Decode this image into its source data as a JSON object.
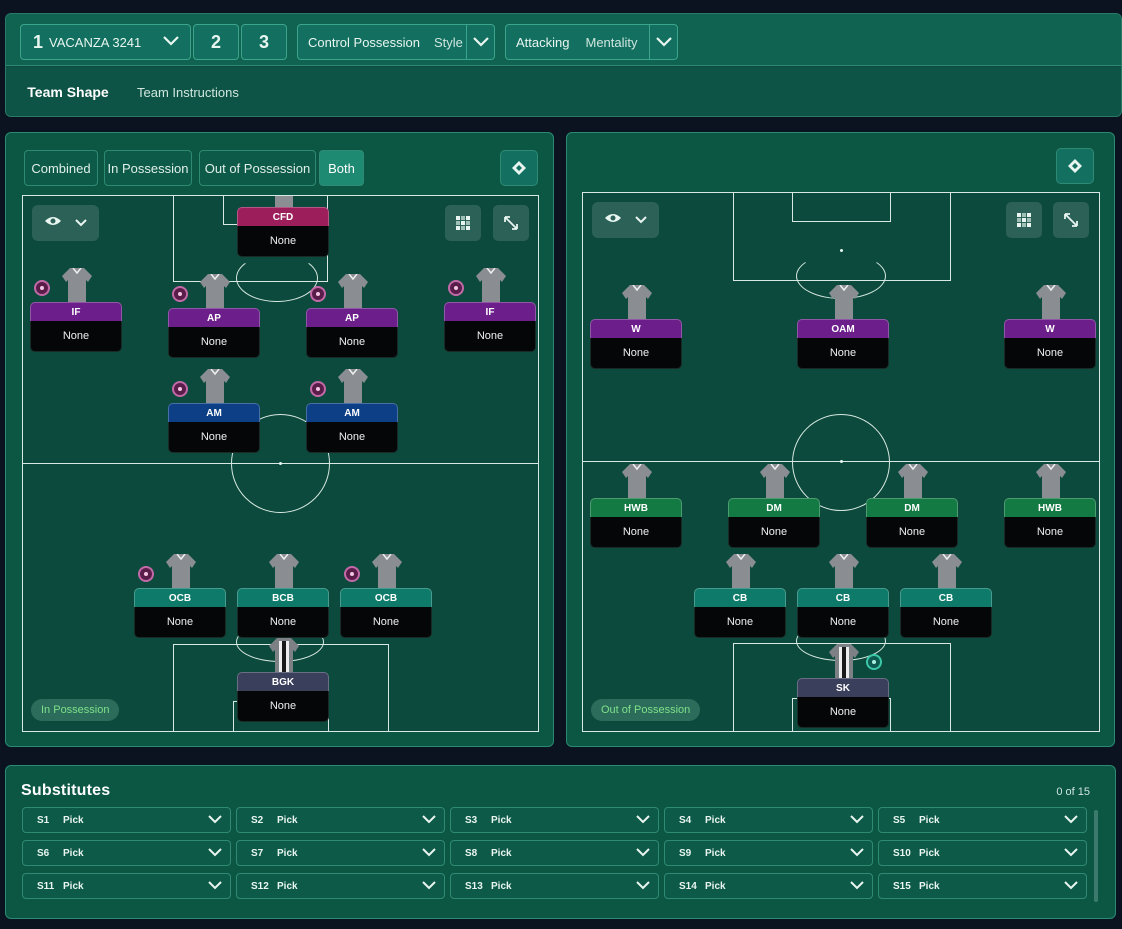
{
  "tactics": [
    {
      "number": "1",
      "name": "VACANZA 3241"
    },
    {
      "number": "2"
    },
    {
      "number": "3"
    }
  ],
  "style": {
    "value": "Control Possession",
    "label": "Style"
  },
  "mentality": {
    "value": "Attacking",
    "label": "Mentality"
  },
  "tabs": [
    "Team Shape",
    "Team Instructions"
  ],
  "view_modes": [
    "Combined",
    "In Possession",
    "Out of Possession",
    "Both"
  ],
  "in_possession": {
    "label": "In Possession",
    "players": [
      {
        "role": "CFD",
        "name": "None"
      },
      {
        "role": "IF",
        "name": "None"
      },
      {
        "role": "AP",
        "name": "None"
      },
      {
        "role": "AP",
        "name": "None"
      },
      {
        "role": "IF",
        "name": "None"
      },
      {
        "role": "AM",
        "name": "None"
      },
      {
        "role": "AM",
        "name": "None"
      },
      {
        "role": "OCB",
        "name": "None"
      },
      {
        "role": "BCB",
        "name": "None"
      },
      {
        "role": "OCB",
        "name": "None"
      },
      {
        "role": "BGK",
        "name": "None"
      }
    ]
  },
  "out_of_possession": {
    "label": "Out of Possession",
    "players": [
      {
        "role": "W",
        "name": "None"
      },
      {
        "role": "OAM",
        "name": "None"
      },
      {
        "role": "W",
        "name": "None"
      },
      {
        "role": "HWB",
        "name": "None"
      },
      {
        "role": "DM",
        "name": "None"
      },
      {
        "role": "DM",
        "name": "None"
      },
      {
        "role": "HWB",
        "name": "None"
      },
      {
        "role": "CB",
        "name": "None"
      },
      {
        "role": "CB",
        "name": "None"
      },
      {
        "role": "CB",
        "name": "None"
      },
      {
        "role": "SK",
        "name": "None"
      }
    ]
  },
  "substitutes": {
    "title": "Substitutes",
    "count": "0 of 15",
    "slots": [
      {
        "id": "S1",
        "value": "Pick"
      },
      {
        "id": "S2",
        "value": "Pick"
      },
      {
        "id": "S3",
        "value": "Pick"
      },
      {
        "id": "S4",
        "value": "Pick"
      },
      {
        "id": "S5",
        "value": "Pick"
      },
      {
        "id": "S6",
        "value": "Pick"
      },
      {
        "id": "S7",
        "value": "Pick"
      },
      {
        "id": "S8",
        "value": "Pick"
      },
      {
        "id": "S9",
        "value": "Pick"
      },
      {
        "id": "S10",
        "value": "Pick"
      },
      {
        "id": "S11",
        "value": "Pick"
      },
      {
        "id": "S12",
        "value": "Pick"
      },
      {
        "id": "S13",
        "value": "Pick"
      },
      {
        "id": "S14",
        "value": "Pick"
      },
      {
        "id": "S15",
        "value": "Pick"
      }
    ]
  },
  "colors": {
    "forward_role": "#6c1f8a",
    "striker_role": "#9c1f5c",
    "attacking_mid_role": "#0d3f86",
    "midfield_role": "#137a43",
    "defender_role": "#0e7a6a",
    "keeper_role": "#3a3f5c",
    "pitch": "#0b4a3c",
    "panel": "#0c5644"
  }
}
